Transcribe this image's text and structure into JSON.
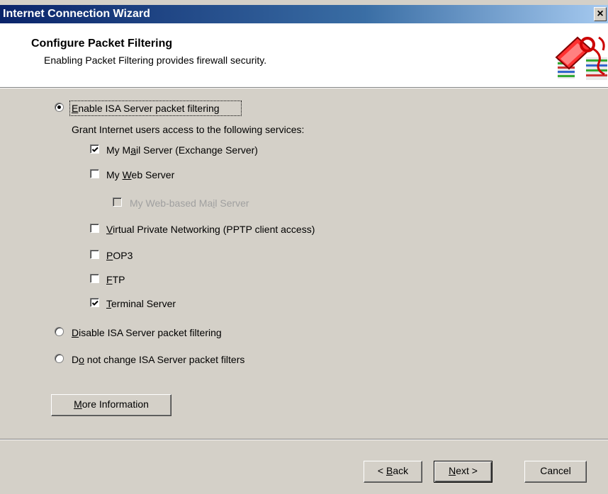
{
  "window": {
    "title": "Internet Connection Wizard",
    "close_glyph": "×"
  },
  "header": {
    "title": "Configure Packet Filtering",
    "subtitle": "Enabling Packet Filtering provides firewall security.",
    "icon": "firewall-key-icon"
  },
  "options": {
    "enable": {
      "pre": "",
      "mnemonic": "E",
      "post": "nable ISA Server packet filtering",
      "selected": true
    },
    "grant_text": "Grant Internet users access to the following services:",
    "services": {
      "mail": {
        "pre": "My M",
        "mnemonic": "a",
        "post": "il Server (Exchange Server)",
        "checked": true,
        "enabled": true
      },
      "web": {
        "pre": "My ",
        "mnemonic": "W",
        "post": "eb Server",
        "checked": false,
        "enabled": true
      },
      "webmail": {
        "pre": "My Web-based Ma",
        "mnemonic": "i",
        "post": "l Server",
        "checked": false,
        "enabled": false
      },
      "vpn": {
        "pre": "",
        "mnemonic": "V",
        "post": "irtual Private Networking (PPTP client access)",
        "checked": false,
        "enabled": true
      },
      "pop3": {
        "pre": "",
        "mnemonic": "P",
        "post": "OP3",
        "checked": false,
        "enabled": true
      },
      "ftp": {
        "pre": "",
        "mnemonic": "F",
        "post": "TP",
        "checked": false,
        "enabled": true
      },
      "terminal": {
        "pre": "",
        "mnemonic": "T",
        "post": "erminal Server",
        "checked": true,
        "enabled": true
      }
    },
    "disable": {
      "pre": "",
      "mnemonic": "D",
      "post": "isable ISA Server packet filtering",
      "selected": false
    },
    "nochange": {
      "pre": "D",
      "mnemonic": "o",
      "post": " not change ISA Server packet filters",
      "selected": false
    }
  },
  "buttons": {
    "more_info": {
      "pre": "",
      "mnemonic": "M",
      "post": "ore Information"
    },
    "back": {
      "pre": "< ",
      "mnemonic": "B",
      "post": "ack"
    },
    "next": {
      "pre": "",
      "mnemonic": "N",
      "post": "ext >"
    },
    "cancel": "Cancel"
  },
  "colors": {
    "titlebar_start": "#0a246a",
    "titlebar_end": "#a6caf0",
    "dialog_bg": "#d4d0c8",
    "header_bg": "#ffffff"
  }
}
